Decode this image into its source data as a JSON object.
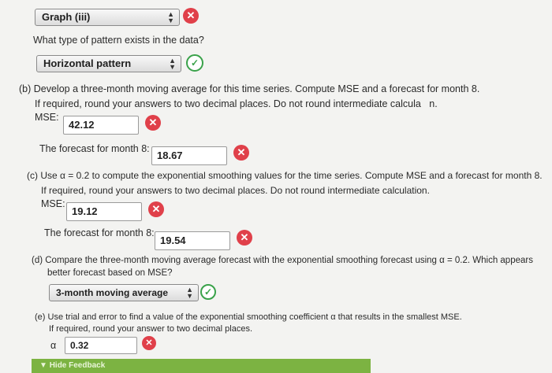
{
  "graph_select": {
    "value": "Graph (iii)"
  },
  "pattern_question": "What type of pattern exists in the data?",
  "pattern_select": {
    "value": "Horizontal pattern"
  },
  "part_b": {
    "text_line1": "(b) Develop a three-month moving average for this time series. Compute MSE and a forecast for month 8.",
    "text_line2": "If required, round your answers to two decimal places. Do not round intermediate calcula",
    "text_line2_end": "n.",
    "mse_label": "MSE:",
    "mse_value": "42.12",
    "forecast_label": "The forecast for month 8:",
    "forecast_value": "18.67"
  },
  "part_c": {
    "text_line1": "(c) Use α = 0.2 to compute the exponential smoothing values for the time series. Compute MSE and a forecast for month 8.",
    "text_line2": "If required, round your answers to two decimal places. Do not round intermediate calculation.",
    "mse_label": "MSE:",
    "mse_value": "19.12",
    "forecast_label": "The forecast for month 8:",
    "forecast_value": "19.54"
  },
  "part_d": {
    "text_line1": "(d) Compare the three-month moving average forecast with the exponential smoothing forecast using α = 0.2. Which appears",
    "text_line2": "better forecast based on MSE?",
    "select_value": "3-month moving average"
  },
  "part_e": {
    "text_line1": "(e) Use trial and error to find a value of the exponential smoothing coefficient α that results in the smallest MSE.",
    "text_line2": "If required, round your answer to two decimal places.",
    "alpha_label": "α",
    "alpha_value": "0.32"
  },
  "feedback": {
    "label": "Hide Feedback"
  },
  "icons": {
    "x": "✕",
    "check": "✓",
    "arrows_up": "▲",
    "arrows_down": "▼"
  }
}
